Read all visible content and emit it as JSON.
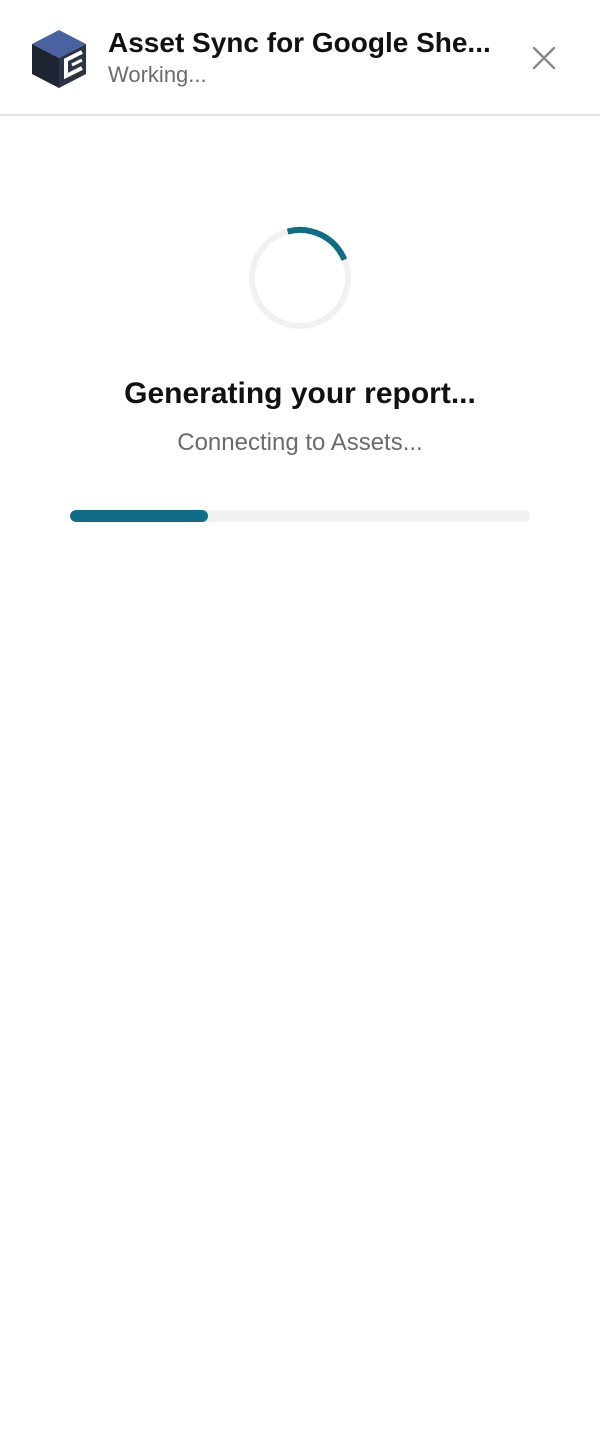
{
  "header": {
    "title": "Asset Sync for Google She...",
    "status": "Working...",
    "logo_icon": "cube-logo-icon",
    "close_icon": "close-icon"
  },
  "main": {
    "heading": "Generating your report...",
    "subtext": "Connecting to Assets...",
    "progress_percent": 30
  },
  "colors": {
    "accent": "#0f6e86",
    "track": "#f1f1f1",
    "title": "#111111",
    "muted": "#6b6b6b",
    "logo_top": "#4a63a0",
    "logo_dark": "#1f2433"
  }
}
